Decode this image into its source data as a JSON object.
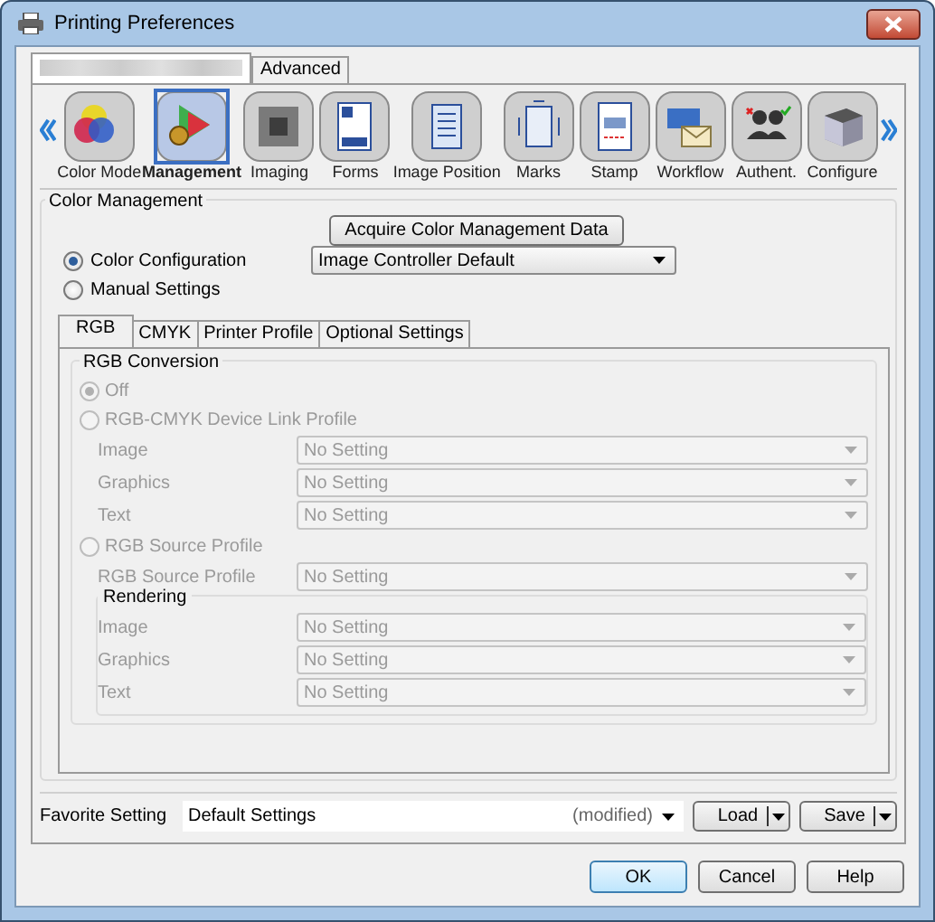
{
  "window": {
    "title": "Printing Preferences"
  },
  "top_tabs": [
    {
      "kind": "redacted",
      "selected": true
    },
    {
      "kind": "text",
      "label": "Advanced",
      "selected": false
    }
  ],
  "categories": [
    {
      "label": "Color Mode",
      "selected": false
    },
    {
      "label": "Management",
      "selected": true
    },
    {
      "label": "Imaging",
      "selected": false
    },
    {
      "label": "Forms",
      "selected": false
    },
    {
      "label": "Image Position",
      "selected": false
    },
    {
      "label": "Marks",
      "selected": false
    },
    {
      "label": "Stamp",
      "selected": false
    },
    {
      "label": "Workflow",
      "selected": false
    },
    {
      "label": "Authent.",
      "selected": false
    },
    {
      "label": "Configure",
      "selected": false
    }
  ],
  "color_management": {
    "title": "Color Management",
    "acquire_button": "Acquire Color Management Data",
    "modes": [
      {
        "label": "Color Configuration",
        "selected": true,
        "value": "Image Controller Default"
      },
      {
        "label": "Manual Settings",
        "selected": false
      }
    ]
  },
  "sub_tabs": [
    {
      "label": "RGB",
      "selected": true
    },
    {
      "label": "CMYK",
      "selected": false
    },
    {
      "label": "Printer Profile",
      "selected": false
    },
    {
      "label": "Optional Settings",
      "selected": false
    }
  ],
  "rgb_conversion": {
    "title": "RGB Conversion",
    "disabled": true,
    "options": [
      {
        "label": "Off",
        "selected": true
      },
      {
        "label": "RGB-CMYK Device Link Profile",
        "selected": false,
        "fields": [
          {
            "label": "Image",
            "value": "No Setting"
          },
          {
            "label": "Graphics",
            "value": "No Setting"
          },
          {
            "label": "Text",
            "value": "No Setting"
          }
        ]
      },
      {
        "label": "RGB Source Profile",
        "selected": false,
        "fields": [
          {
            "label": "RGB Source Profile",
            "value": "No Setting"
          }
        ],
        "subgroup": {
          "title": "Rendering",
          "fields": [
            {
              "label": "Image",
              "value": "No Setting"
            },
            {
              "label": "Graphics",
              "value": "No Setting"
            },
            {
              "label": "Text",
              "value": "No Setting"
            }
          ]
        }
      }
    ]
  },
  "favorite": {
    "label": "Favorite Setting",
    "value": "Default Settings",
    "note": "(modified)",
    "buttons": [
      "Load",
      "Save"
    ]
  },
  "buttons": [
    {
      "label": "OK",
      "default": true
    },
    {
      "label": "Cancel",
      "default": false
    },
    {
      "label": "Help",
      "default": false
    }
  ]
}
